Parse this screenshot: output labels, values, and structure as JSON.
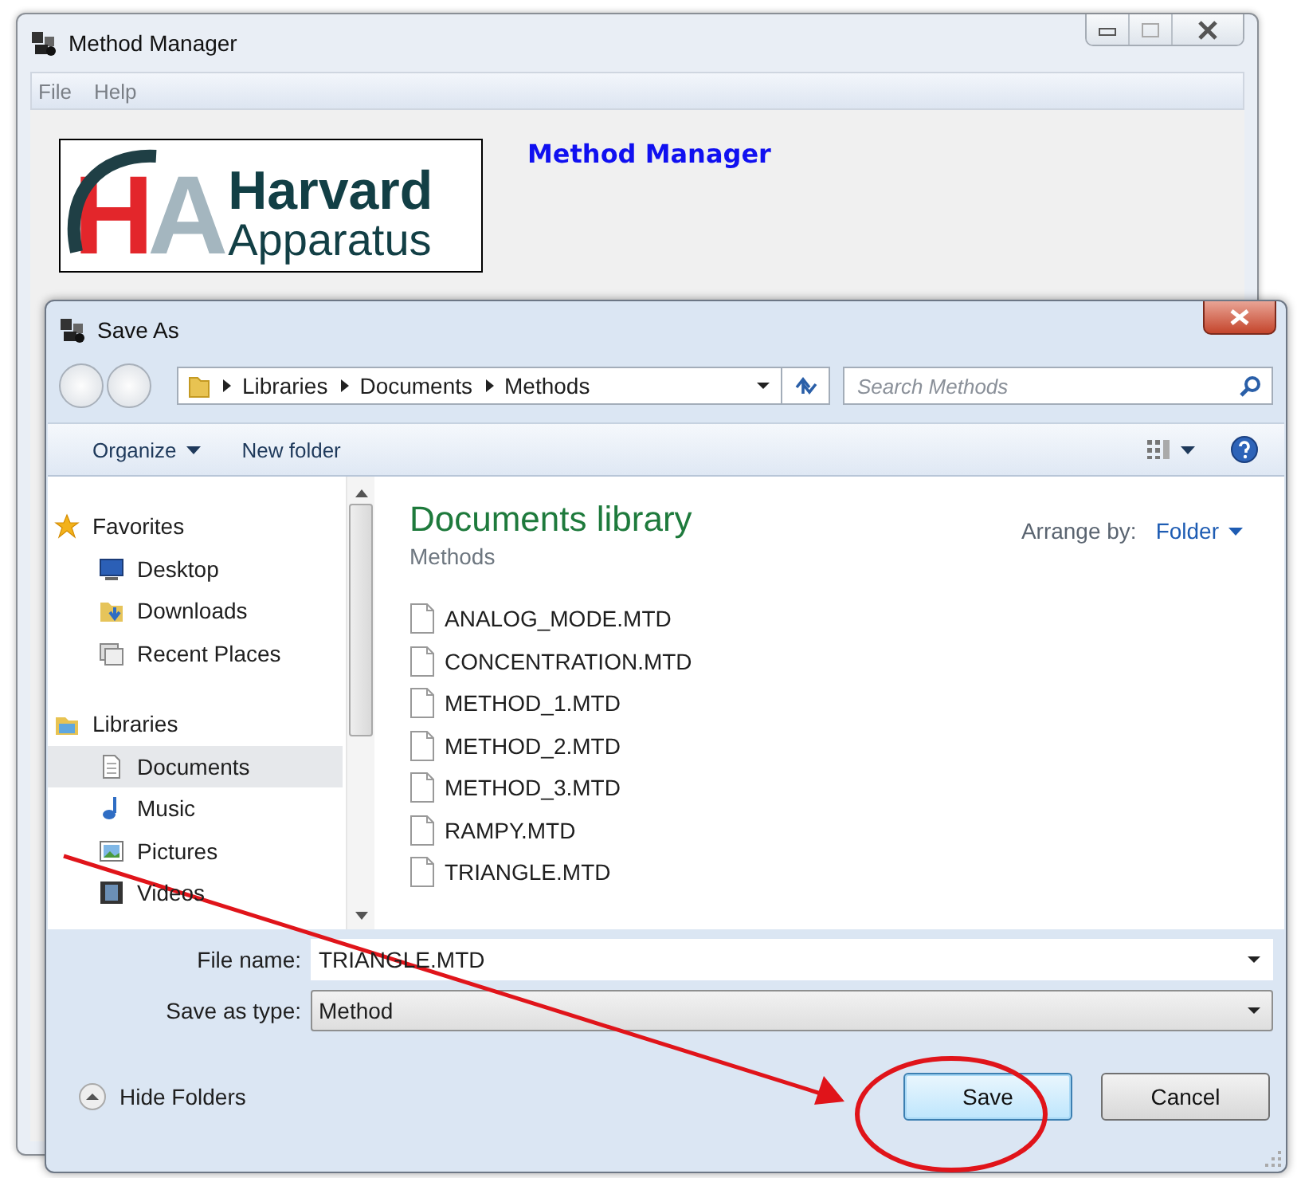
{
  "main_window": {
    "title": "Method Manager",
    "menu": [
      "File",
      "Help"
    ],
    "logo": {
      "letters": "HA",
      "line_1": "Harvard",
      "line_2": "Apparatus"
    },
    "heading": "Method Manager"
  },
  "dialog": {
    "title": "Save As",
    "breadcrumb": [
      "Libraries",
      "Documents",
      "Methods"
    ],
    "search": {
      "placeholder": "Search Methods"
    },
    "toolbar": [
      {
        "label": "Organize",
        "dropdown": true
      },
      {
        "label": "New folder",
        "dropdown": false
      }
    ],
    "navigation": [
      {
        "label": "Favorites",
        "kind": "star",
        "selected": false,
        "children": [
          {
            "label": "Desktop",
            "kind": "desktop",
            "selected": false
          },
          {
            "label": "Downloads",
            "kind": "downloads",
            "selected": false
          },
          {
            "label": "Recent Places",
            "kind": "recent",
            "selected": false
          }
        ]
      },
      {
        "label": "Libraries",
        "kind": "library",
        "selected": false,
        "children": [
          {
            "label": "Documents",
            "kind": "documents",
            "selected": true
          },
          {
            "label": "Music",
            "kind": "music",
            "selected": false
          },
          {
            "label": "Pictures",
            "kind": "pictures",
            "selected": false
          },
          {
            "label": "Videos",
            "kind": "videos",
            "selected": false
          }
        ]
      }
    ],
    "library_title": "Documents library",
    "library_subtitle": "Methods",
    "arrange_label": "Arrange by:",
    "arrange_value": "Folder",
    "files": [
      "ANALOG_MODE.MTD",
      "CONCENTRATION.MTD",
      "METHOD_1.MTD",
      "METHOD_2.MTD",
      "METHOD_3.MTD",
      "RAMPY.MTD",
      "TRIANGLE.MTD"
    ],
    "file_name": {
      "label": "File name:",
      "value": "TRIANGLE.MTD"
    },
    "save_as_type": {
      "label": "Save as type:",
      "value": "Method"
    },
    "hide_folders": "Hide Folders",
    "buttons": [
      {
        "label": "Save",
        "default": true
      },
      {
        "label": "Cancel",
        "default": false
      }
    ]
  }
}
